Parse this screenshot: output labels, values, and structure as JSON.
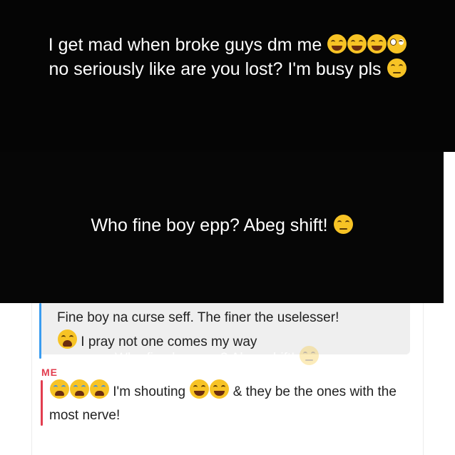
{
  "story_top": {
    "line1": "I get mad when broke guys dm me",
    "line1_emoji": [
      "face-with-tears-of-joy",
      "face-with-tears-of-joy",
      "face-with-tears-of-joy",
      "flushed-face"
    ],
    "line2": "no seriously like are you lost? I'm busy pls",
    "line2_emoji": [
      "unamused-face"
    ]
  },
  "story_middle": {
    "text": "Who fine boy epp? Abeg shift!",
    "emoji": [
      "unamused-face"
    ]
  },
  "reply": {
    "quoted_line1": "Fine boy na curse seff. The finer the uselesser!",
    "quoted_line2": "I pray not one comes my way",
    "quoted_emoji": [
      "weary-face"
    ],
    "ghost_text": "Who fine boy epp? Abeg shift!",
    "quote_bar_color": "#3a9cf0"
  },
  "message": {
    "sender": "ME",
    "sender_color": "#e23d4f",
    "text_part1": "I'm shouting",
    "text_part2": "& they be the ones",
    "text_part3": "with the most nerve!",
    "lead_emoji": [
      "loudly-crying-face",
      "loudly-crying-face",
      "loudly-crying-face"
    ],
    "mid_emoji": [
      "face-with-tears-of-joy",
      "face-with-tears-of-joy"
    ]
  }
}
